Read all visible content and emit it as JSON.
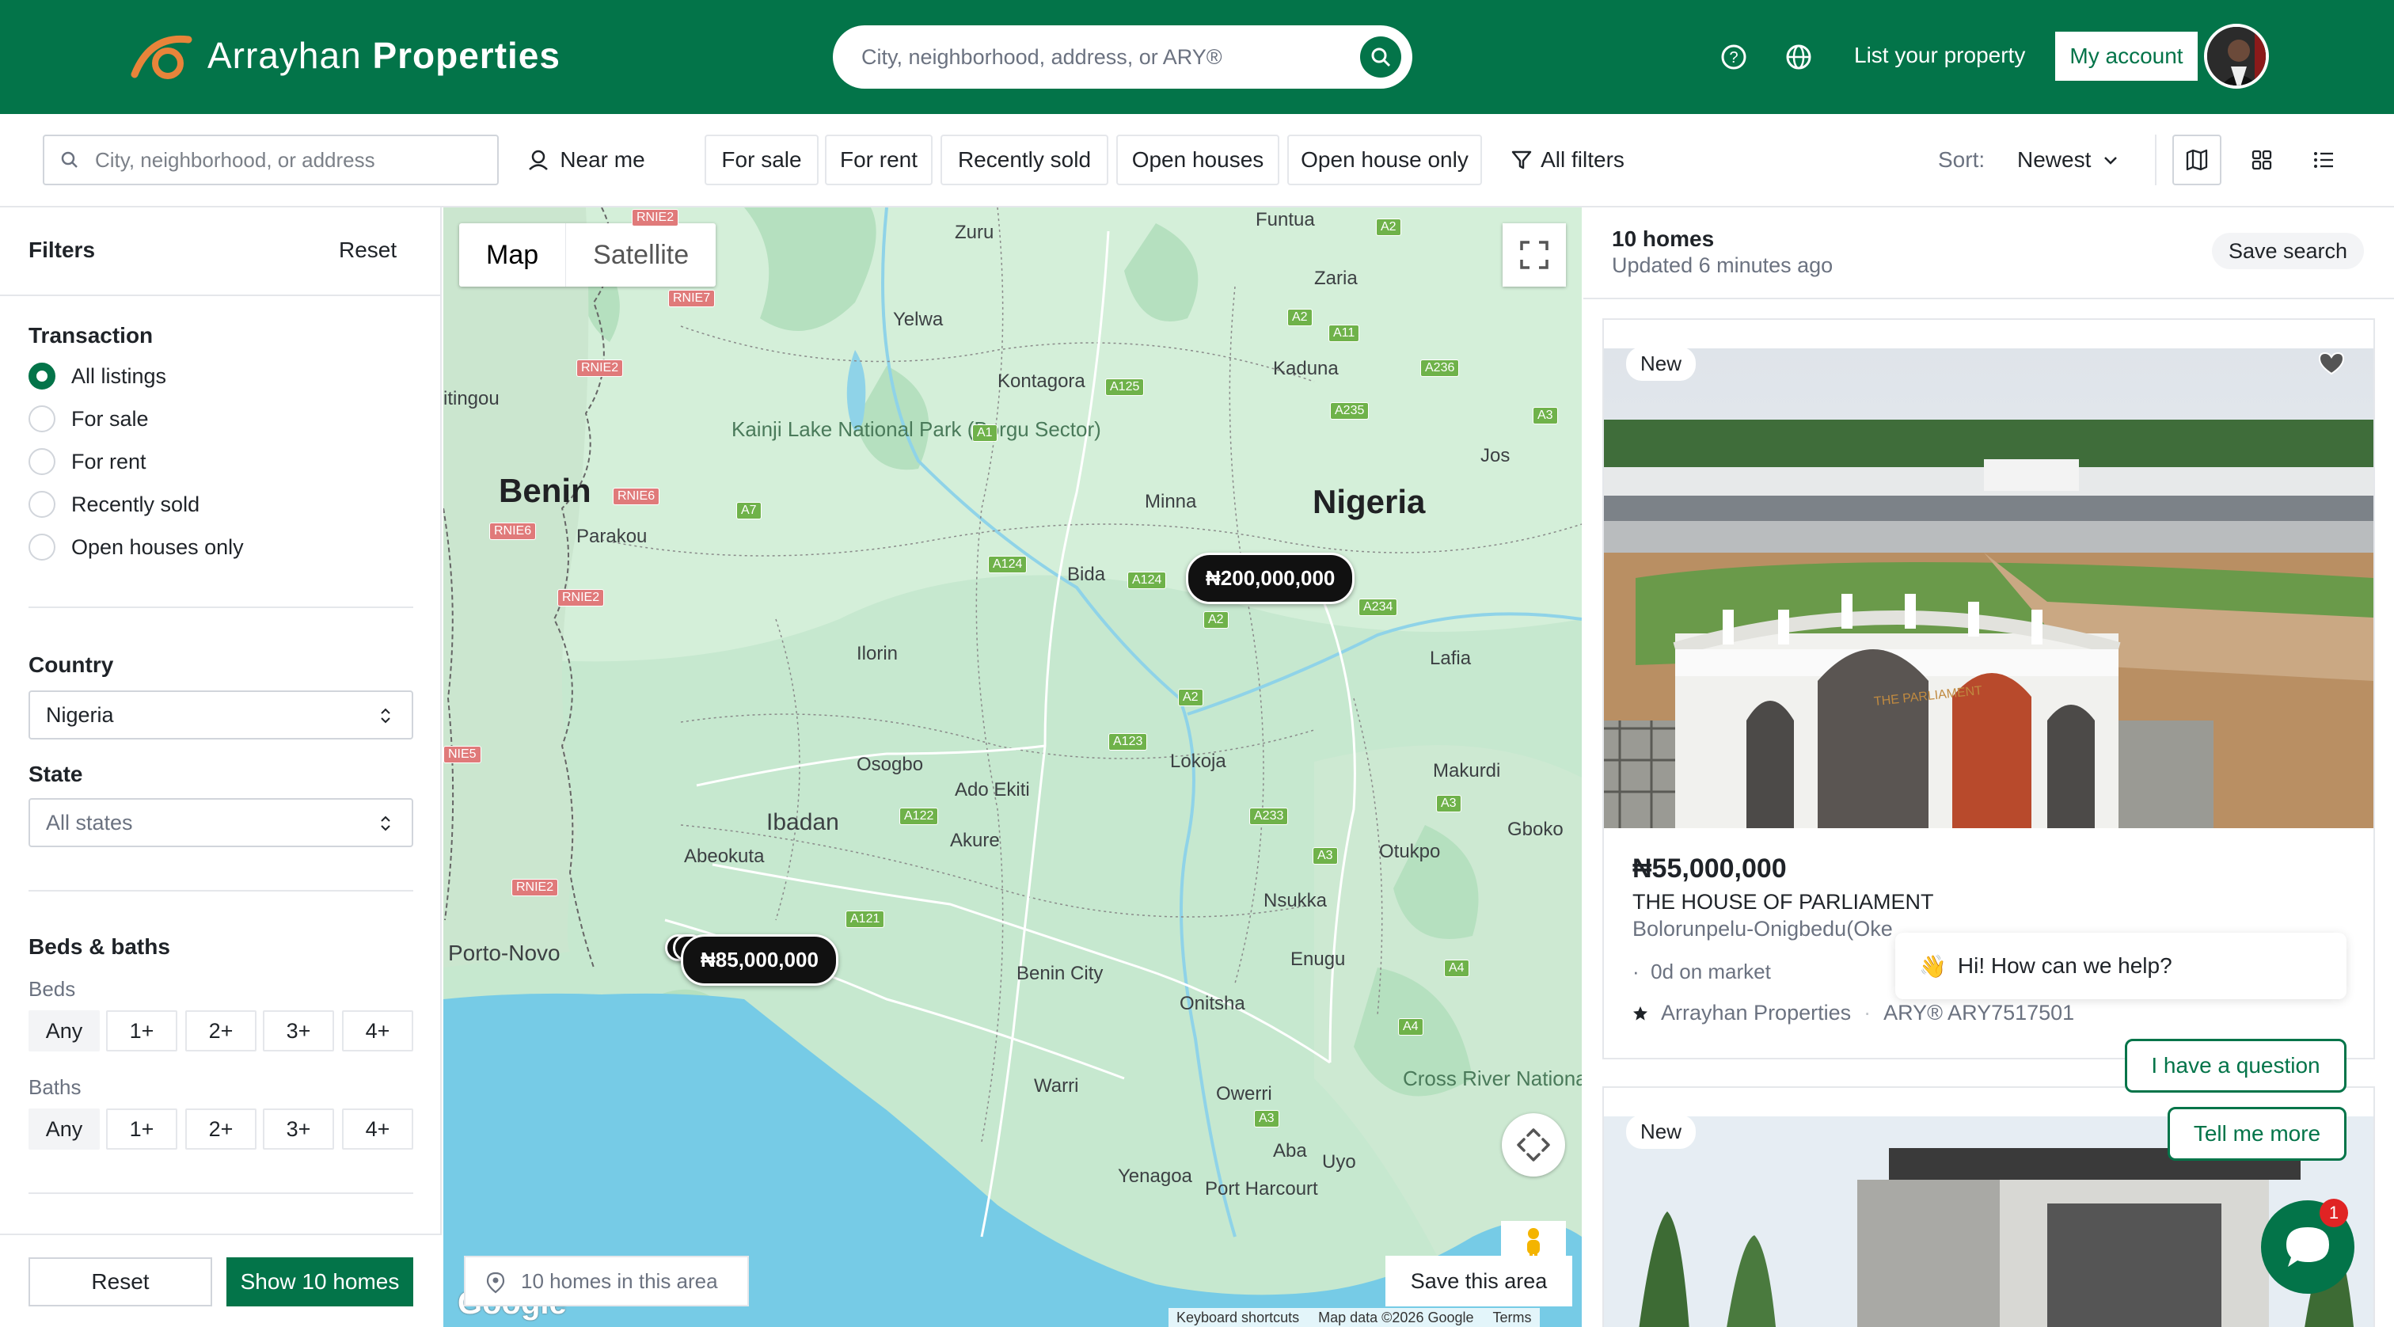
{
  "header": {
    "brand_light": "Arrayhan",
    "brand_bold": "Properties",
    "search_placeholder": "City, neighborhood, address, or ARY®",
    "list_property": "List your property",
    "my_account": "My account",
    "accent": "#037449"
  },
  "filterbar": {
    "search_placeholder": "City, neighborhood, or address",
    "near_me": "Near me",
    "chips": [
      "For sale",
      "For rent",
      "Recently sold",
      "Open houses",
      "Open house only"
    ],
    "all_filters": "All filters",
    "sort_label": "Sort:",
    "sort_value": "Newest"
  },
  "filters": {
    "title": "Filters",
    "reset": "Reset",
    "transaction_title": "Transaction",
    "transaction_options": [
      "All listings",
      "For sale",
      "For rent",
      "Recently sold",
      "Open houses only"
    ],
    "transaction_selected": "All listings",
    "country_title": "Country",
    "country_value": "Nigeria",
    "state_title": "State",
    "state_value": "All states",
    "beds_baths_title": "Beds & baths",
    "beds_label": "Beds",
    "baths_label": "Baths",
    "options": [
      "Any",
      "1+",
      "2+",
      "3+",
      "4+"
    ],
    "footer_reset": "Reset",
    "footer_show": "Show 10 homes"
  },
  "map": {
    "tab_map": "Map",
    "tab_satellite": "Satellite",
    "country_labels": [
      "Nigeria",
      "Benin"
    ],
    "cities": [
      "Zuru",
      "Funtua",
      "Zaria",
      "Yelwa",
      "Kontagora",
      "Kaduna",
      "Jos",
      "Minna",
      "Parakou",
      "Bida",
      "Ilorin",
      "Lafia",
      "Lokoja",
      "Makurdi",
      "Osogbo",
      "Ado Ekiti",
      "Ibadan",
      "Akure",
      "Abeokuta",
      "Otukpo",
      "Gboko",
      "Nsukka",
      "Porto-Novo",
      "Benin City",
      "Enugu",
      "Onitsha",
      "Warri",
      "Owerri",
      "Aba",
      "Uyo",
      "Yenagoa",
      "Port Harcourt",
      "itingou"
    ],
    "parks": [
      "Kainji Lake National Park (Borgu Sector)",
      "Cross River National Park"
    ],
    "price_pins": [
      "₦200,000,000",
      "₦85,000,000"
    ],
    "homes_in_area": "10 homes in this area",
    "save_area": "Save this area",
    "attribution": [
      "Keyboard shortcuts",
      "Map data ©2026 Google",
      "Terms"
    ],
    "google": "Google"
  },
  "results": {
    "count": "10 homes",
    "updated": "Updated 6 minutes ago",
    "save_search": "Save search",
    "listings": [
      {
        "badge": "New",
        "price": "₦55,000,000",
        "title": "THE HOUSE OF PARLIAMENT",
        "address": "Bolorunpelu-Onigbedu(Oke",
        "days": "0d on market",
        "agency": "Arrayhan Properties",
        "ary": "ARY® ARY7517501",
        "gate_sign": "THE PARLIAMENT"
      },
      {
        "badge": "New"
      }
    ]
  },
  "chat": {
    "greeting": "Hi! How can we help?",
    "btn_question": "I have a question",
    "btn_more": "Tell me more",
    "unread": "1"
  }
}
